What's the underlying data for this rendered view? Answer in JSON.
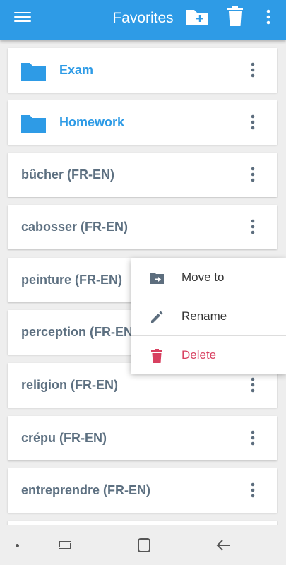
{
  "header": {
    "title": "Favorites",
    "bg_color": "#2e9be6",
    "icons": [
      "menu-icon",
      "new-folder-icon",
      "trash-icon",
      "more-vert-icon"
    ]
  },
  "folders": [
    {
      "label": "Exam",
      "icon": "folder-icon"
    },
    {
      "label": "Homework",
      "icon": "folder-icon"
    }
  ],
  "entries": [
    {
      "label": "bûcher (FR-EN)"
    },
    {
      "label": "cabosser (FR-EN)"
    },
    {
      "label": "peinture (FR-EN)"
    },
    {
      "label": "perception (FR-EN)"
    },
    {
      "label": "religion (FR-EN)"
    },
    {
      "label": "crépu (FR-EN)"
    },
    {
      "label": "entreprendre (FR-EN)"
    }
  ],
  "context_menu": {
    "items": [
      {
        "label": "Move to",
        "icon": "move-to-folder-icon"
      },
      {
        "label": "Rename",
        "icon": "pencil-icon"
      },
      {
        "label": "Delete",
        "icon": "trash-icon",
        "color": "#d84060"
      }
    ]
  },
  "navbar": {
    "icons": [
      "dot-indicator-icon",
      "recent-apps-icon",
      "home-icon",
      "back-icon"
    ]
  },
  "colors": {
    "accent": "#2e9be6",
    "entry_text": "#5d7081",
    "delete": "#d84060",
    "background": "#eeeeee"
  }
}
